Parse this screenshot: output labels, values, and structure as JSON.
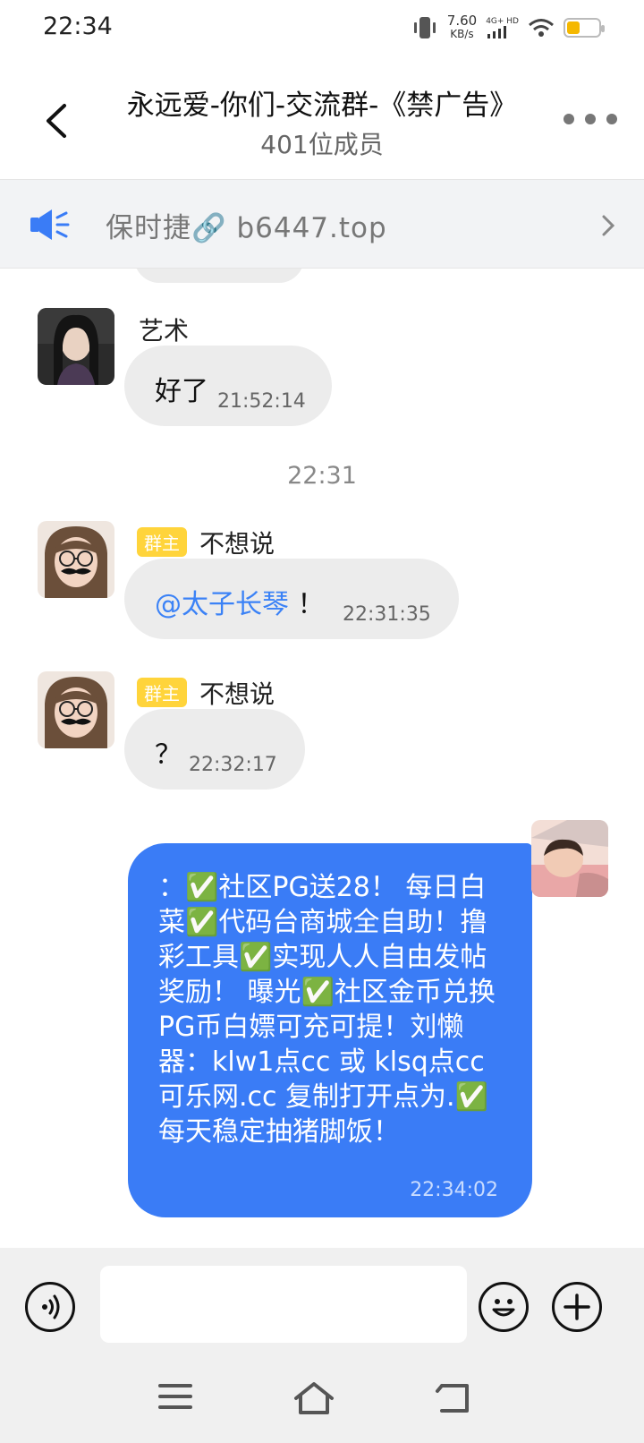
{
  "status": {
    "time": "22:34",
    "speed_value": "7.60",
    "speed_unit": "KB/s",
    "network": "4G+ HD"
  },
  "header": {
    "title": "永远爱-你们-交流群-《禁广告》",
    "member_count": "401位成员"
  },
  "announcement": {
    "text": "保时捷🔗 b6447.top"
  },
  "messages": [
    {
      "sender": "艺术",
      "text": "好了",
      "time": "21:52:14"
    },
    {
      "badge": "群主",
      "sender": "不想说",
      "mention": "@太子长琴",
      "text": "！",
      "time": "22:31:35"
    },
    {
      "badge": "群主",
      "sender": "不想说",
      "text": "？",
      "time": "22:32:17"
    }
  ],
  "divider_time": "22:31",
  "my_message": {
    "text": "：✅社区PG送28！ 每日白菜✅代码台商城全自助！撸彩工具✅实现人人自由发帖奖励！ 曝光✅社区金币兑换PG币白嫖可充可提！刘懒器：klw1点cc 或 klsq点cc 可乐网.cc 复制打开点为.✅每天稳定抽猪脚饭！",
    "time": "22:34:02"
  },
  "colors": {
    "accent": "#3a7cf6",
    "badge": "#ffd43b",
    "mention": "#3b82f6"
  }
}
